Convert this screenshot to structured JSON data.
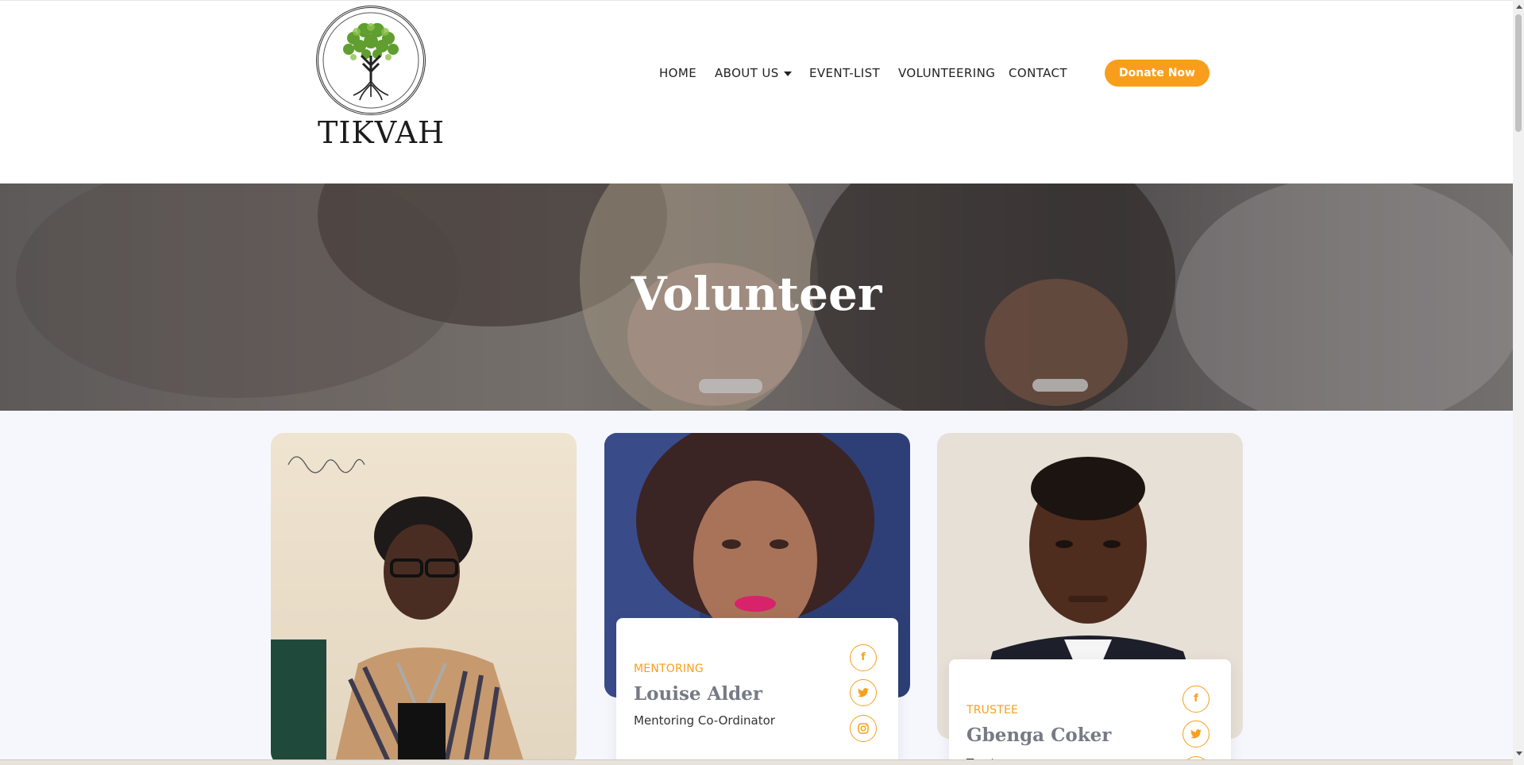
{
  "site": {
    "logo_text": "TIKVAH"
  },
  "nav": {
    "home": "HOME",
    "about": "ABOUT US",
    "events": "EVENT-LIST",
    "volunteering": "VOLUNTEERING",
    "contact": "CONTACT",
    "donate": "Donate Now"
  },
  "hero": {
    "title": "Volunteer"
  },
  "team": [
    {
      "role": "",
      "name": "",
      "title": ""
    },
    {
      "role": "MENTORING",
      "name": "Louise Alder",
      "title": "Mentoring Co-Ordinator"
    },
    {
      "role": "TRUSTEE",
      "name": "Gbenga Coker",
      "title": "Trustee"
    }
  ],
  "social_icons": [
    "facebook-icon",
    "twitter-icon",
    "instagram-icon"
  ],
  "colors": {
    "accent": "#f99e1c",
    "name_text": "#777a85",
    "page_bg": "#f6f7fd"
  }
}
